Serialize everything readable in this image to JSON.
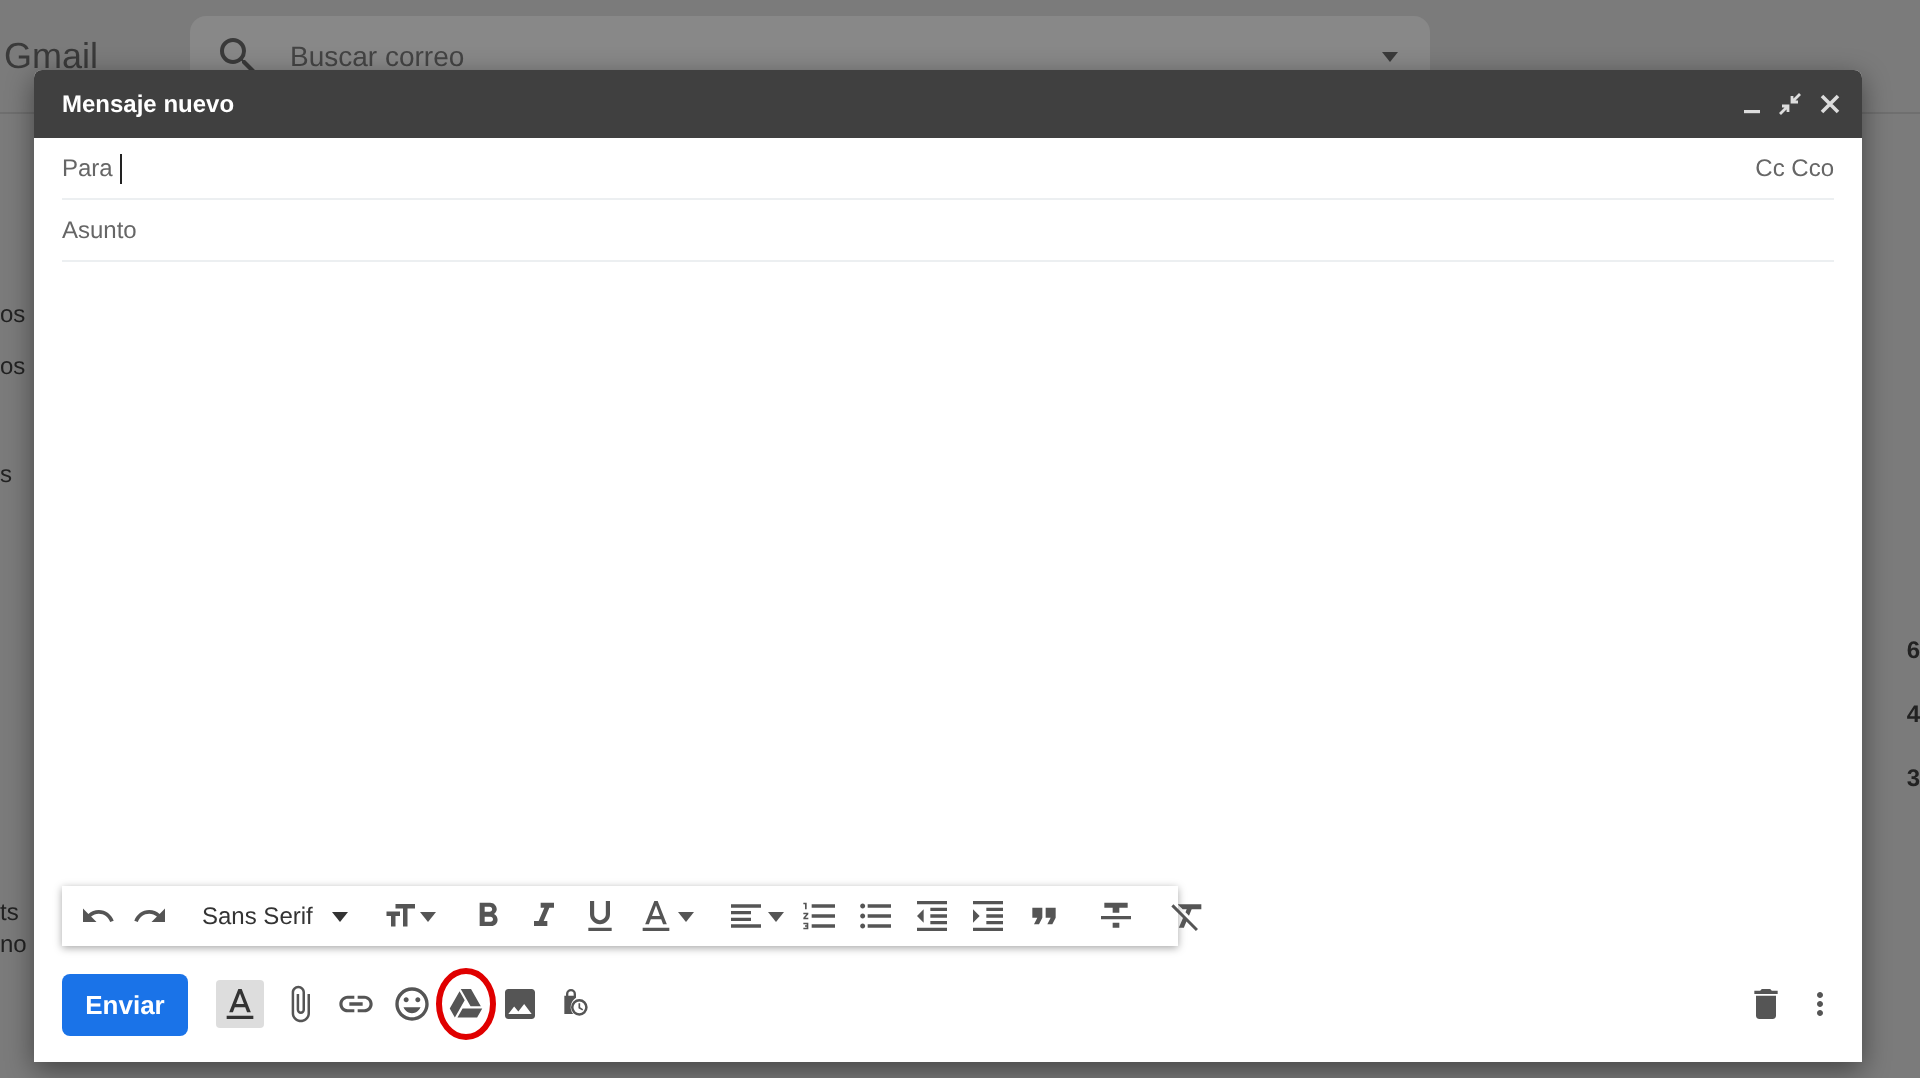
{
  "background": {
    "logo": "Gmail",
    "search_placeholder": "Buscar correo",
    "left_fragments": [
      "os",
      "os",
      "s",
      "ts",
      "no"
    ],
    "right_fragments": [
      "6",
      "4",
      "3"
    ]
  },
  "compose": {
    "title": "Mensaje nuevo",
    "to_label": "Para",
    "cc_links": "Cc Cco",
    "subject_placeholder": "Asunto",
    "format_toolbar": {
      "font": "Sans Serif"
    },
    "send_button": "Enviar",
    "formatting_toggle": {
      "selected": true
    },
    "drive_highlighted": true
  }
}
